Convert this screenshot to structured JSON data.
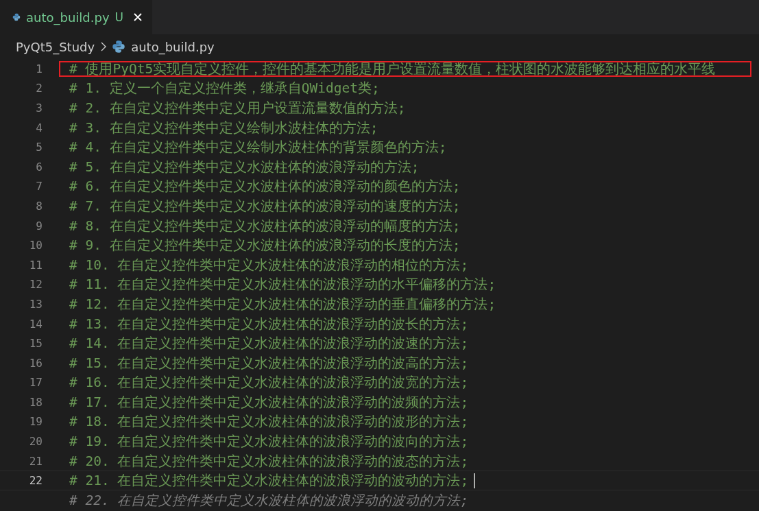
{
  "tab": {
    "label": "auto_build.py",
    "status": "U",
    "selected": true
  },
  "breadcrumb": [
    "PyQt5_Study",
    "auto_build.py"
  ],
  "lines": [
    {
      "kind": "code",
      "number": "1",
      "text": "# 使用PyQt5实现自定义控件，控件的基本功能是用户设置流量数值，柱状图的水波能够到达相应的水平线",
      "current": false,
      "highlighted": true
    },
    {
      "kind": "code",
      "number": "2",
      "text": "# 1. 定义一个自定义控件类，继承自QWidget类;",
      "current": false,
      "highlighted": false
    },
    {
      "kind": "code",
      "number": "3",
      "text": "# 2. 在自定义控件类中定义用户设置流量数值的方法;",
      "current": false,
      "highlighted": false
    },
    {
      "kind": "code",
      "number": "4",
      "text": "# 3. 在自定义控件类中定义绘制水波柱体的方法;",
      "current": false,
      "highlighted": false
    },
    {
      "kind": "code",
      "number": "5",
      "text": "# 4. 在自定义控件类中定义绘制水波柱体的背景颜色的方法;",
      "current": false,
      "highlighted": false
    },
    {
      "kind": "code",
      "number": "6",
      "text": "# 5. 在自定义控件类中定义水波柱体的波浪浮动的方法;",
      "current": false,
      "highlighted": false
    },
    {
      "kind": "code",
      "number": "7",
      "text": "# 6. 在自定义控件类中定义水波柱体的波浪浮动的颜色的方法;",
      "current": false,
      "highlighted": false
    },
    {
      "kind": "code",
      "number": "8",
      "text": "# 7. 在自定义控件类中定义水波柱体的波浪浮动的速度的方法;",
      "current": false,
      "highlighted": false
    },
    {
      "kind": "code",
      "number": "9",
      "text": "# 8. 在自定义控件类中定义水波柱体的波浪浮动的幅度的方法;",
      "current": false,
      "highlighted": false
    },
    {
      "kind": "code",
      "number": "10",
      "text": "# 9. 在自定义控件类中定义水波柱体的波浪浮动的长度的方法;",
      "current": false,
      "highlighted": false
    },
    {
      "kind": "code",
      "number": "11",
      "text": "# 10. 在自定义控件类中定义水波柱体的波浪浮动的相位的方法;",
      "current": false,
      "highlighted": false
    },
    {
      "kind": "code",
      "number": "12",
      "text": "# 11. 在自定义控件类中定义水波柱体的波浪浮动的水平偏移的方法;",
      "current": false,
      "highlighted": false
    },
    {
      "kind": "code",
      "number": "13",
      "text": "# 12. 在自定义控件类中定义水波柱体的波浪浮动的垂直偏移的方法;",
      "current": false,
      "highlighted": false
    },
    {
      "kind": "code",
      "number": "14",
      "text": "# 13. 在自定义控件类中定义水波柱体的波浪浮动的波长的方法;",
      "current": false,
      "highlighted": false
    },
    {
      "kind": "code",
      "number": "15",
      "text": "# 14. 在自定义控件类中定义水波柱体的波浪浮动的波速的方法;",
      "current": false,
      "highlighted": false
    },
    {
      "kind": "code",
      "number": "16",
      "text": "# 15. 在自定义控件类中定义水波柱体的波浪浮动的波高的方法;",
      "current": false,
      "highlighted": false
    },
    {
      "kind": "code",
      "number": "17",
      "text": "# 16. 在自定义控件类中定义水波柱体的波浪浮动的波宽的方法;",
      "current": false,
      "highlighted": false
    },
    {
      "kind": "code",
      "number": "18",
      "text": "# 17. 在自定义控件类中定义水波柱体的波浪浮动的波频的方法;",
      "current": false,
      "highlighted": false
    },
    {
      "kind": "code",
      "number": "19",
      "text": "# 18. 在自定义控件类中定义水波柱体的波浪浮动的波形的方法;",
      "current": false,
      "highlighted": false
    },
    {
      "kind": "code",
      "number": "20",
      "text": "# 19. 在自定义控件类中定义水波柱体的波浪浮动的波向的方法;",
      "current": false,
      "highlighted": false
    },
    {
      "kind": "code",
      "number": "21",
      "text": "# 20. 在自定义控件类中定义水波柱体的波浪浮动的波态的方法;",
      "current": false,
      "highlighted": false
    },
    {
      "kind": "code",
      "number": "22",
      "text": "# 21. 在自定义控件类中定义水波柱体的波浪浮动的波动的方法;",
      "current": true,
      "highlighted": false
    },
    {
      "kind": "ghost",
      "text": "# 22. 在自定义控件类中定义水波柱体的波浪浮动的波动的方法;"
    }
  ]
}
